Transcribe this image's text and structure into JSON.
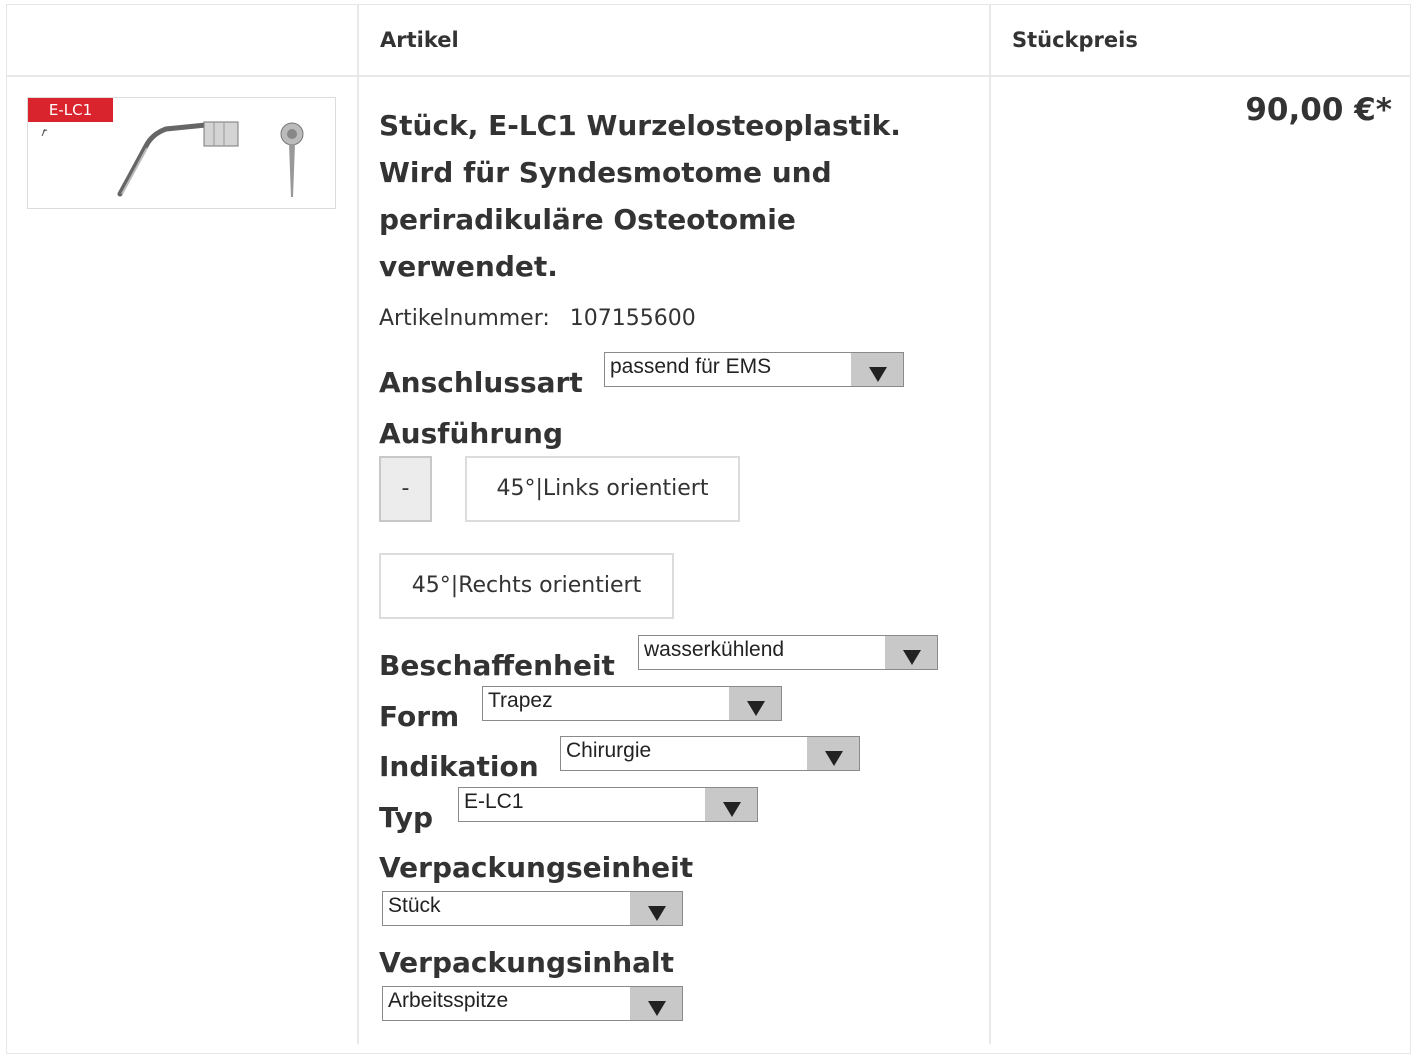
{
  "table": {
    "headers": {
      "article": "Artikel",
      "unit_price": "Stückpreis"
    }
  },
  "product": {
    "badge": "E-LC1",
    "title": "Stück, E-LC1 Wurzelosteoplastik. Wird für Syndesmotome und periradikuläre Osteotomie verwendet.",
    "article_number_label": "Artikelnummer:",
    "article_number": "107155600",
    "price": "90,00 €*"
  },
  "options": {
    "anschlussart": {
      "label": "Anschlussart",
      "value": "passend für EMS"
    },
    "ausfuehrung": {
      "label": "Ausführung",
      "buttons": [
        "-",
        "45°|Links orientiert",
        "45°|Rechts orientiert"
      ]
    },
    "beschaffenheit": {
      "label": "Beschaffenheit",
      "value": "wasserkühlend"
    },
    "form": {
      "label": "Form",
      "value": "Trapez"
    },
    "indikation": {
      "label": "Indikation",
      "value": "Chirurgie"
    },
    "typ": {
      "label": "Typ",
      "value": "E-LC1"
    },
    "verpackungseinheit": {
      "label": "Verpackungseinheit",
      "value": "Stück"
    },
    "verpackungsinhalt": {
      "label": "Verpackungsinhalt",
      "value": "Arbeitsspitze"
    }
  },
  "icons": {
    "dropdown": "chevron-down-icon",
    "product_image": "ultrasonic-tip-image"
  }
}
